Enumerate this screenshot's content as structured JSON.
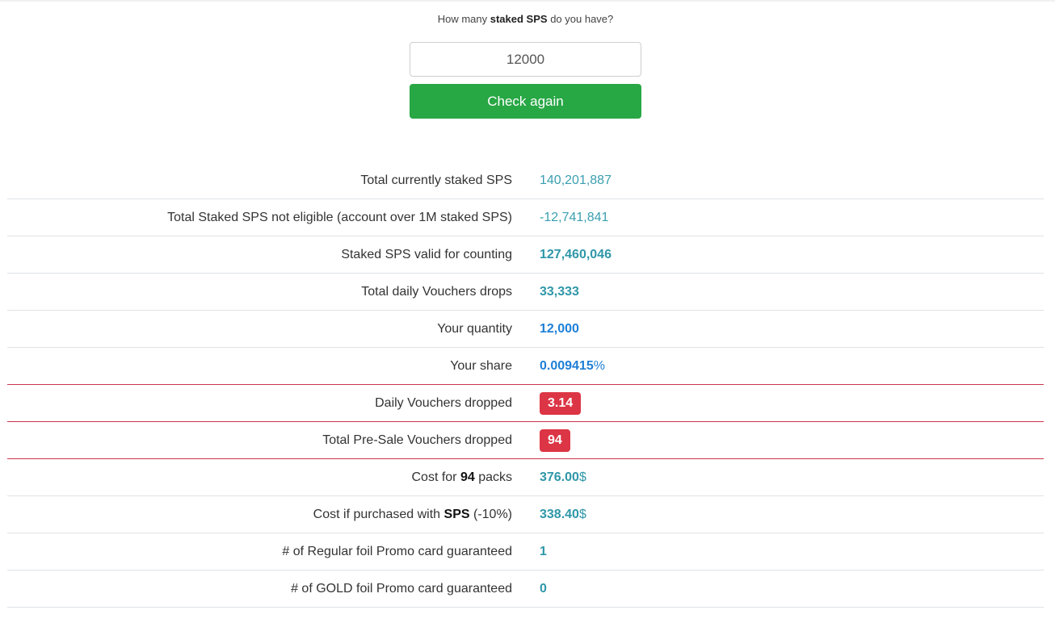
{
  "form": {
    "question_prefix": "How many ",
    "question_bold": "staked SPS",
    "question_suffix": " do you have?",
    "input_value": "12000",
    "button_label": "Check again"
  },
  "rows": {
    "total_staked": {
      "label": "Total currently staked SPS",
      "value": "140,201,887"
    },
    "not_eligible": {
      "label": "Total Staked SPS not eligible (account over 1M staked SPS)",
      "value": "-12,741,841"
    },
    "valid": {
      "label": "Staked SPS valid for counting",
      "value": "127,460,046"
    },
    "daily_drops": {
      "label": "Total daily Vouchers drops",
      "value": "33,333"
    },
    "quantity": {
      "label": "Your quantity",
      "value": "12,000"
    },
    "share": {
      "label": "Your share",
      "value": "0.009415",
      "unit": "%"
    },
    "daily_dropped": {
      "label": "Daily Vouchers dropped",
      "value": "3.14"
    },
    "presale_dropped": {
      "label": "Total Pre-Sale Vouchers dropped",
      "value": "94"
    },
    "cost_packs": {
      "label_prefix": "Cost for ",
      "label_bold": "94",
      "label_suffix": " packs",
      "value": "376.00",
      "unit": "$"
    },
    "cost_sps": {
      "label_prefix": "Cost if purchased with ",
      "label_bold": "SPS",
      "label_suffix": " (-10%)",
      "value": "338.40",
      "unit": "$"
    },
    "regular_promo": {
      "label": "# of Regular foil Promo card guaranteed",
      "value": "1"
    },
    "gold_promo": {
      "label": "# of GOLD foil Promo card guaranteed",
      "value": "0"
    }
  },
  "colors": {
    "button_green": "#28a745",
    "badge_red": "#dc3545",
    "value_teal": "#3a9fb0",
    "value_blue": "#1f7fd6"
  }
}
